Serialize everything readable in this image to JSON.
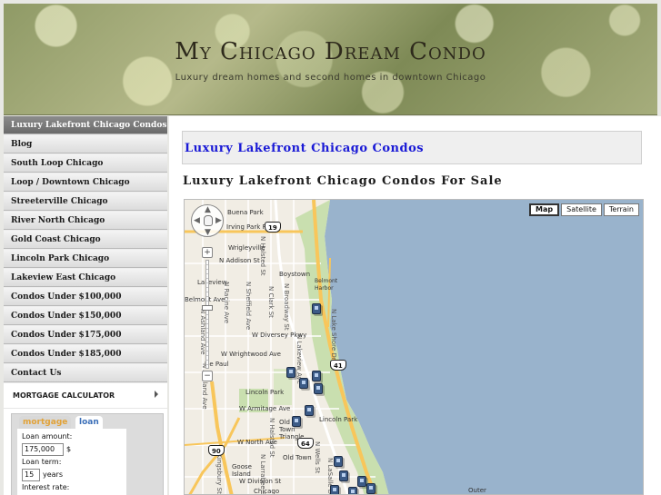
{
  "header": {
    "title": "My Chicago Dream Condo",
    "tagline": "Luxury dream homes and second homes in downtown Chicago"
  },
  "sidebar": {
    "items": [
      {
        "label": "Luxury Lakefront Chicago Condos",
        "active": true
      },
      {
        "label": "Blog"
      },
      {
        "label": "South Loop Chicago"
      },
      {
        "label": "Loop / Downtown Chicago"
      },
      {
        "label": "Streeterville Chicago"
      },
      {
        "label": "River North Chicago"
      },
      {
        "label": "Gold Coast Chicago"
      },
      {
        "label": "Lincoln Park Chicago"
      },
      {
        "label": "Lakeview East Chicago"
      },
      {
        "label": "Condos Under $100,000"
      },
      {
        "label": "Condos Under $150,000"
      },
      {
        "label": "Condos Under $175,000"
      },
      {
        "label": "Condos Under $185,000"
      },
      {
        "label": "Contact Us"
      }
    ]
  },
  "mortgage": {
    "header": "MORTGAGE CALCULATOR",
    "tabs": [
      "mortgage",
      "loan"
    ],
    "loan_amount_label": "Loan amount:",
    "loan_amount_value": "175,000",
    "currency": "$",
    "loan_term_label": "Loan term:",
    "loan_term_value": "15",
    "loan_term_unit": "years",
    "interest_label": "Interest rate:"
  },
  "content": {
    "post_title": "Luxury Lakefront Chicago Condos",
    "section_heading": "Luxury Lakefront Chicago Condos For Sale"
  },
  "map": {
    "type_buttons": [
      "Map",
      "Satellite",
      "Terrain"
    ],
    "active_type": "Map",
    "labels": {
      "buena_park": "Buena Park",
      "irving_park_rd": "Irving Park Rd",
      "wrigleyville": "Wrigleyville",
      "n_addison_st": "N Addison St",
      "boystown": "Boystown",
      "belmont_harbor": "Belmont Harbor",
      "lakeview": "Lakeview",
      "belmont_ave": "Belmont Ave",
      "w_diversey_pkwy": "W Diversey Pkwy",
      "w_wrightwood_ave": "W Wrightwood Ave",
      "de_paul": "De Paul",
      "lincoln_park_1": "Lincoln Park",
      "lincoln_park_2": "Lincoln Park",
      "w_armitage_ave": "W Armitage Ave",
      "old_town_triangle": "Old Town Triangle",
      "w_north_ave": "W North Ave",
      "old_town": "Old Town",
      "goose_island": "Goose Island",
      "w_division_st": "W Division St",
      "chicago": "Chicago",
      "outer": "Outer",
      "n_ashland_ave": "N Ashland Ave",
      "n_racine_ave": "N Racine Ave",
      "n_sheffield_ave": "N Sheffield Ave",
      "n_halsted_st": "N Halsted St",
      "n_clark_st": "N Clark St",
      "n_broadway_st": "N Broadway St",
      "n_lakeview_ave": "N Lakeview Ave",
      "n_lake_shore_dr": "N Lake Shore Dr",
      "n_larrabee_st": "N Larrabee St",
      "n_wells_st": "N Wells St",
      "n_lasalle_dr": "N LaSalle Dr",
      "n_kingsbury_st": "N Kingsbury St"
    },
    "shields": [
      "19",
      "41",
      "64",
      "90"
    ]
  },
  "colors": {
    "link_blue": "#1a1ad6",
    "lake": "#99b3cc",
    "highway": "#f8c65b",
    "park": "#c9dfaf",
    "nav_active": "#7a7a7a"
  }
}
